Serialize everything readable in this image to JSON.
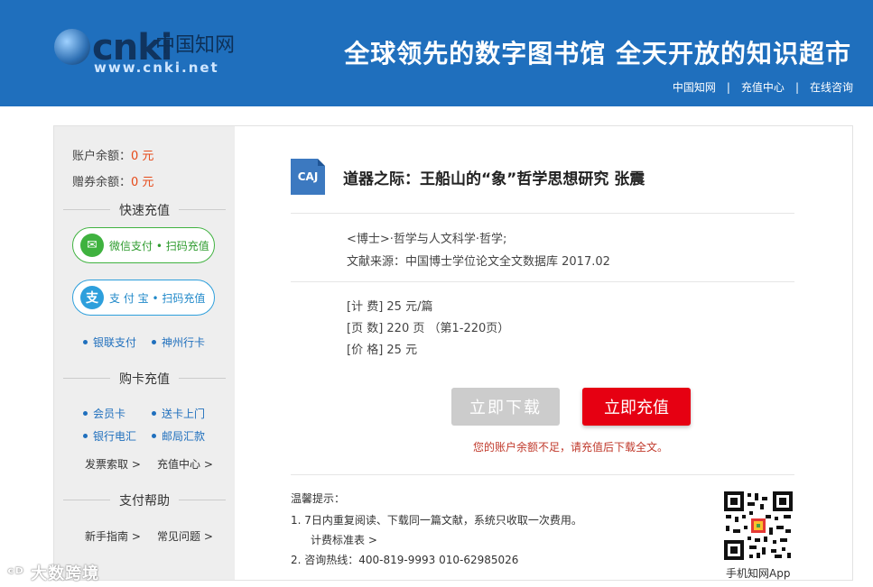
{
  "header": {
    "logo_text": "cnki",
    "logo_cn": "中国知网",
    "logo_url": "www.cnki.net",
    "slogan": "全球领先的数字图书馆  全天开放的知识超市",
    "nav": [
      "中国知网",
      "充值中心",
      "在线咨询"
    ]
  },
  "sidebar": {
    "balance_label": "账户余额：",
    "balance_value": "0 元",
    "coupon_label": "赠券余额：",
    "coupon_value": "0 元",
    "quick_recharge": "快速充值",
    "wechat_label": "微信支付 • 扫码充值",
    "alipay_label": "支 付 宝 • 扫码充值",
    "unionpay": "银联支付",
    "shenzhou": "神州行卡",
    "buy_card": "购卡充值",
    "member_card": "会员卡",
    "deliver_card": "送卡上门",
    "bank_transfer": "银行电汇",
    "post_remit": "邮局汇款",
    "invoice": "发票索取 >",
    "recharge_center": "充值中心 >",
    "pay_help": "支付帮助",
    "newbie": "新手指南 >",
    "faq": "常见问题 >"
  },
  "doc": {
    "icon_label": "CAJ",
    "title": "道器之际：王船山的“象”哲学思想研究 张震",
    "category": "<博士>·哲学与人文科学·哲学;",
    "source": "文献来源：中国博士学位论文全文数据库 2017.02",
    "fee": "[计 费] 25 元/篇",
    "pages": "[页 数] 220 页 （第1-220页）",
    "price": "[价 格] 25 元",
    "download_btn": "立即下载",
    "recharge_btn": "立即充值",
    "warning": "您的账户余额不足，请充值后下载全文。"
  },
  "tips": {
    "title": "温馨提示：",
    "tip1": "1.  7日内重复阅读、下载同一篇文献，系统只收取一次费用。",
    "tip1_link": "计费标准表 >",
    "tip2": "2.  咨询热线：400-819-9993    010-62985026",
    "qr_label": "手机知网App"
  },
  "watermark": "大数跨境"
}
